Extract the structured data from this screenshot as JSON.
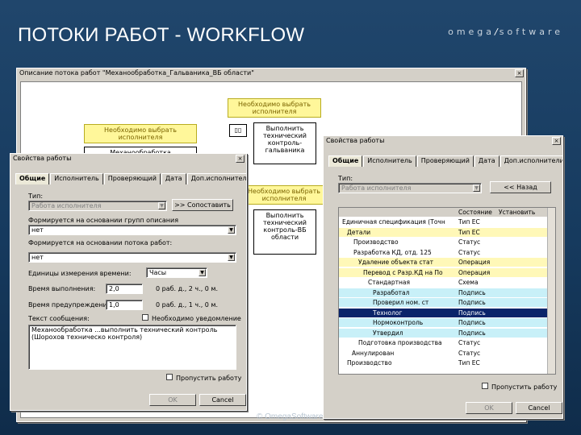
{
  "slide": {
    "title": "ПОТОКИ РАБОТ - WORKFLOW",
    "brand_a": "omega",
    "brand_b": "software",
    "footer": "© OmegaSoftware"
  },
  "main_window": {
    "title": "Описание потока работ \"Механообработка_Гальваника_ВБ области\""
  },
  "diagram": {
    "yellow_top": "Необходимо выбрать исполнителя",
    "yellow_left": "Необходимо выбрать исполнителя",
    "yellow_mid": "Необходимо выбрать исполнителя",
    "node_left": "Механообработка",
    "node_top": "Выполнить технический контроль-гальваника",
    "node_mid": "Выполнить технический контроль-ВБ области",
    "start_icon": "▯▯"
  },
  "props_left": {
    "title": "Свойства работы",
    "tabs": [
      "Общие",
      "Исполнитель",
      "Проверяющий",
      "Дата",
      "Доп.исполнители"
    ],
    "type_label": "Тип:",
    "type_value": "Работа исполнителя",
    "match_button": ">> Сопоставить",
    "formed_label": "Формируется на основании групп описания",
    "formed_value": "нет",
    "formed2_label": "Формируется на основании потока работ:",
    "formed2_value": "нет",
    "units_label": "Единицы измерения времени:",
    "units_value": "Часы",
    "exec_label": "Время выполнения:",
    "exec_value": "2,0",
    "exec_hint": "0 раб. д., 2 ч., 0 м.",
    "warn_label": "Время предупреждения:",
    "warn_value": "1,0",
    "warn_hint": "0 раб. д., 1 ч., 0 м.",
    "msg_label": "Текст сообщения:",
    "notify_label": "Необходимо уведомление",
    "msg_value": "Механообработка ...выполнить технический контроль (Шорохов техническо контроля)",
    "skip_label": "Пропустить работу",
    "ok": "OK",
    "cancel": "Cancel"
  },
  "props_right": {
    "title": "Свойства работы",
    "tabs": [
      "Общие",
      "Исполнитель",
      "Проверяющий",
      "Дата",
      "Доп.исполнители"
    ],
    "type_label": "Тип:",
    "type_value": "Работа исполнителя",
    "back_button": "<< Назад",
    "col_state": "Состояние",
    "col_set": "Установить",
    "rows": [
      {
        "name": "Единичная спецификация (Точн",
        "type": "Тип ЕС",
        "hl": ""
      },
      {
        "name": "Детали",
        "type": "Тип ЕС",
        "hl": "y"
      },
      {
        "name": "Производство",
        "type": "Статус",
        "hl": ""
      },
      {
        "name": "Разработка КД, отд. 125",
        "type": "Статус",
        "hl": ""
      },
      {
        "name": "Удаление объекта стат",
        "type": "Операция",
        "hl": "y"
      },
      {
        "name": "Перевод с Разр.КД на По",
        "type": "Операция",
        "hl": "y"
      },
      {
        "name": "Стандартная",
        "type": "Схема",
        "hl": ""
      },
      {
        "name": "Разработал",
        "type": "Подпись",
        "hl": "c"
      },
      {
        "name": "Проверил ном. ст",
        "type": "Подпись",
        "hl": "c"
      },
      {
        "name": "Технолог",
        "type": "Подпись",
        "hl": "s"
      },
      {
        "name": "Нормоконтроль",
        "type": "Подпись",
        "hl": "c"
      },
      {
        "name": "Утвердил",
        "type": "Подпись",
        "hl": "c"
      },
      {
        "name": "Подготовка производства",
        "type": "Статус",
        "hl": ""
      },
      {
        "name": "Аннулирован",
        "type": "Статус",
        "hl": ""
      },
      {
        "name": "Производство",
        "type": "Тип ЕС",
        "hl": ""
      }
    ],
    "skip_label": "Пропустить работу",
    "ok": "OK",
    "cancel": "Cancel"
  }
}
